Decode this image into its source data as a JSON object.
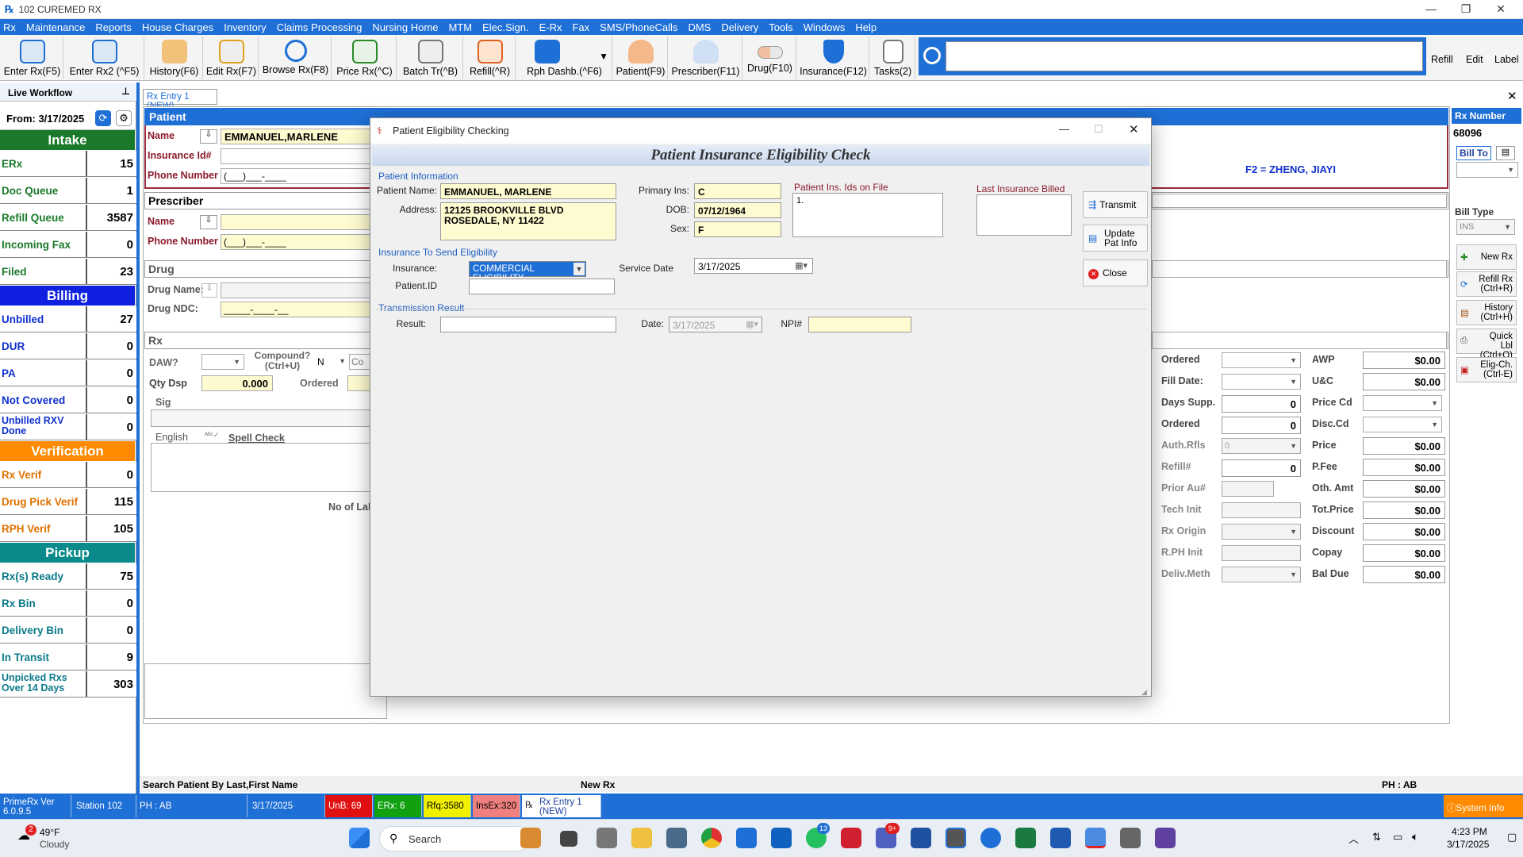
{
  "window": {
    "title": "102 CUREMED RX"
  },
  "menu": [
    "Rx",
    "Maintenance",
    "Reports",
    "House Charges",
    "Inventory",
    "Claims Processing",
    "Nursing Home",
    "MTM",
    "Elec.Sign.",
    "E-Rx",
    "Fax",
    "SMS/PhoneCalls",
    "DMS",
    "Delivery",
    "Tools",
    "Windows",
    "Help"
  ],
  "toolbar": {
    "enter_rx": "Enter Rx(F5)",
    "enter_rx2": "Enter Rx2 (^F5)",
    "history": "History(F6)",
    "edit_rx": "Edit Rx(F7)",
    "browse_rx": "Browse Rx(F8)",
    "price_rx": "Price Rx(^C)",
    "batch_tr": "Batch Tr(^B)",
    "refill": "Refill(^R)",
    "rph_dash": "Rph Dashb.(^F6)",
    "patient": "Patient(F9)",
    "prescriber": "Prescriber(F11)",
    "drug": "Drug(F10)",
    "insurance": "Insurance(F12)",
    "tasks": "Tasks(2)",
    "right_refill": "Refill",
    "right_edit": "Edit",
    "right_label": "Label"
  },
  "workflow": {
    "title": "Live Workflow",
    "from_label": "From: 3/17/2025",
    "intake": "Intake",
    "billing": "Billing",
    "verification": "Verification",
    "pickup": "Pickup",
    "rows": [
      {
        "label": "ERx",
        "value": "15"
      },
      {
        "label": "Doc Queue",
        "value": "1"
      },
      {
        "label": "Refill Queue",
        "value": "3587"
      },
      {
        "label": "Incoming Fax",
        "value": "0"
      },
      {
        "label": "Filed",
        "value": "23"
      },
      {
        "label": "Unbilled",
        "value": "27"
      },
      {
        "label": "DUR",
        "value": "0"
      },
      {
        "label": "PA",
        "value": "0"
      },
      {
        "label": "Not Covered",
        "value": "0"
      },
      {
        "label": "Unbilled RXV Done",
        "value": "0"
      },
      {
        "label": "Rx Verif",
        "value": "0"
      },
      {
        "label": "Drug Pick Verif",
        "value": "115"
      },
      {
        "label": "RPH Verif",
        "value": "105"
      },
      {
        "label": "Rx(s) Ready",
        "value": "75"
      },
      {
        "label": "Rx Bin",
        "value": "0"
      },
      {
        "label": "Delivery Bin",
        "value": "0"
      },
      {
        "label": "In Transit",
        "value": "9"
      },
      {
        "label": "Unpicked Rxs Over 14 Days",
        "value": "303"
      }
    ]
  },
  "rxentry": {
    "tab": "Rx Entry 1 (NEW)",
    "patient_hdr": "Patient",
    "name_label": "Name",
    "patient_name": "EMMANUEL,MARLENE",
    "insurance_id_label": "Insurance Id#",
    "phone_label": "Phone Number",
    "phone_mask": "(___)___-____",
    "prescriber_hdr": "Prescriber",
    "pres_name_label": "Name",
    "pres_phone_label": "Phone Number",
    "pres_phone_mask": "(___)___-____",
    "drug_hdr": "Drug",
    "drug_name_label": "Drug Name:",
    "drug_ndc_label": "Drug NDC:",
    "drug_ndc_mask": "_____-____-__",
    "rx_hdr": "Rx",
    "daw_label": "DAW?",
    "compound_label": "Compound? (Ctrl+U)",
    "compound_value": "N",
    "co_label": "Co",
    "qty_label": "Qty Dsp",
    "qty_value": "0.000",
    "ordered_label": "Ordered",
    "sig_label": "Sig",
    "english_label": "English",
    "spell_check": "Spell Check",
    "no_lab": "No of Lab",
    "rx_number_label": "Rx Number",
    "rx_number": "68096",
    "bill_to": "Bill To",
    "f2_label": "F2 = ZHENG, JIAYI",
    "bill_type_label": "Bill Type",
    "bill_type": "INS",
    "right_labels": [
      "Ordered",
      "Fill Date:",
      "Days Supp.",
      "Ordered",
      "Auth.Rfls",
      "Refill#",
      "Prior Au#",
      "Tech Init",
      "Rx Origin",
      "R.PH Init",
      "Deliv.Meth"
    ],
    "right_vals": [
      "",
      "",
      "0",
      "0",
      "0",
      "0",
      "",
      "",
      "",
      "",
      ""
    ],
    "price_labels": [
      "AWP",
      "U&C",
      "Price Cd",
      "Disc.Cd",
      "Price",
      "P.Fee",
      "Oth. Amt",
      "Tot.Price",
      "Discount",
      "Copay",
      "Bal Due"
    ],
    "price_vals": [
      "$0.00",
      "$0.00",
      "",
      "",
      "$0.00",
      "$0.00",
      "$0.00",
      "$0.00",
      "$0.00",
      "$0.00",
      "$0.00"
    ],
    "side_buttons": {
      "new_rx": "New Rx",
      "refill_rx": "Refill Rx (Ctrl+R)",
      "history": "History (Ctrl+H)",
      "quick_lbl": "Quick Lbl (Ctrl+Q)",
      "elig": "Elig-Ch. (Ctrl-E)"
    }
  },
  "dialog": {
    "caption": "Patient Eligibility Checking",
    "banner": "Patient Insurance Eligibility Check",
    "patient_info": "Patient Information",
    "patient_name_label": "Patient Name:",
    "patient_name": "EMMANUEL, MARLENE",
    "address_label": "Address:",
    "address_line1": "12125 BROOKVILLE BLVD",
    "address_line2": "ROSEDALE, NY 11422",
    "primary_ins_label": "Primary Ins:",
    "primary_ins": "C",
    "dob_label": "DOB:",
    "dob": "07/12/1964",
    "sex_label": "Sex:",
    "sex": "F",
    "ids_on_file_label": "Patient Ins. Ids on File",
    "ids_on_file": "1.",
    "last_ins_label": "Last Insurance Billed",
    "send_group": "Insurance To Send Eligibility",
    "insurance_label": "Insurance:",
    "insurance_value": "COMMERCIAL ELIGIBILITY",
    "service_date_label": "Service Date",
    "service_date": "3/17/2025",
    "patient_id_label": "Patient.ID",
    "transmission_group": "Transmission Result",
    "result_label": "Result:",
    "date_label": "Date:",
    "date_value": "3/17/2025",
    "npi_label": "NPI#",
    "transmit": "Transmit",
    "update": "Update Pat Info",
    "close": "Close"
  },
  "status": {
    "search_hint": "Search Patient By Last,First Name",
    "new_rx": "New Rx",
    "ph": "PH : AB",
    "version": "PrimeRx Ver 6.0.9.5",
    "station": "Station 102",
    "ph2": "PH : AB",
    "date": "3/17/2025",
    "unb": "UnB: 69",
    "erx": "ERx: 6",
    "rfq": "Rfq:3580",
    "insex": "InsEx:320",
    "rxentry": "Rx Entry 1 (NEW)",
    "system_info": "System Info"
  },
  "taskbar": {
    "weather_temp": "49°F",
    "weather_desc": "Cloudy",
    "weather_badge": "2",
    "search": "Search",
    "time": "4:23 PM",
    "date": "3/17/2025",
    "whatsapp_badge": "13",
    "teams_badge": "9+"
  }
}
